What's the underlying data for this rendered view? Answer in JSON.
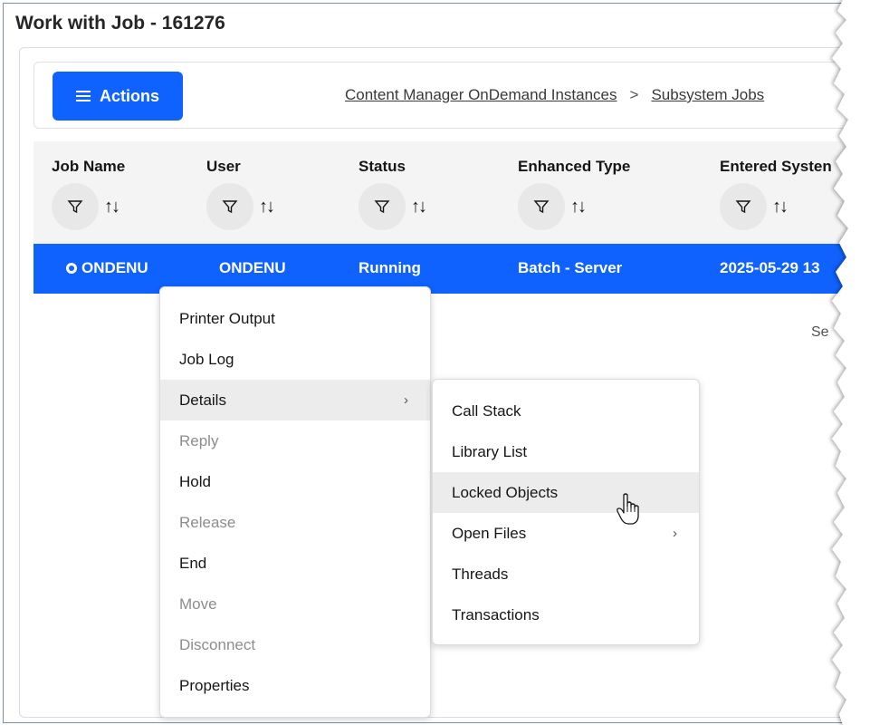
{
  "page": {
    "title": "Work with Job - 161276"
  },
  "toolbar": {
    "actions_label": "Actions",
    "breadcrumb": [
      "Content Manager OnDemand Instances",
      "Subsystem Jobs"
    ],
    "breadcrumb_sep": ">"
  },
  "table": {
    "columns": [
      "Job Name",
      "User",
      "Status",
      "Enhanced Type",
      "Entered Systen"
    ],
    "selected_row": {
      "job_name": "ONDENU",
      "user": "ONDENU",
      "status": "Running",
      "enhanced_type": "Batch - Server",
      "entered_system": "2025-05-29 13"
    },
    "partial_text": "Se"
  },
  "context_menu": {
    "items": [
      {
        "label": "Printer Output",
        "disabled": false
      },
      {
        "label": "Job Log",
        "disabled": false
      },
      {
        "label": "Details",
        "disabled": false,
        "submenu": true
      },
      {
        "label": "Reply",
        "disabled": true
      },
      {
        "label": "Hold",
        "disabled": false
      },
      {
        "label": "Release",
        "disabled": true
      },
      {
        "label": "End",
        "disabled": false
      },
      {
        "label": "Move",
        "disabled": true
      },
      {
        "label": "Disconnect",
        "disabled": true
      },
      {
        "label": "Properties",
        "disabled": false
      }
    ]
  },
  "submenu": {
    "items": [
      {
        "label": "Call Stack"
      },
      {
        "label": "Library List"
      },
      {
        "label": "Locked Objects",
        "hovered": true
      },
      {
        "label": "Open Files",
        "submenu": true
      },
      {
        "label": "Threads"
      },
      {
        "label": "Transactions"
      }
    ]
  },
  "colors": {
    "accent": "#0f62fe",
    "header_bg": "#f4f4f4",
    "hover_bg": "#ececec",
    "disabled_text": "#8d8d8d"
  },
  "icons": [
    "menu-icon",
    "filter-icon",
    "sort-icon",
    "job-status-icon",
    "chevron-right-icon",
    "hand-pointer-icon"
  ]
}
